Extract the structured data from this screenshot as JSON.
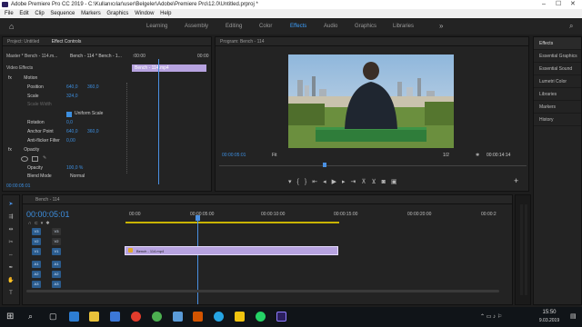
{
  "window": {
    "title": "Adobe Premiere Pro CC 2019 - C:\\Kullanıcılar\\user\\Belgeler\\Adobe\\Premiere Pro\\12.0\\Untitled.prproj *"
  },
  "menu": [
    "File",
    "Edit",
    "Clip",
    "Sequence",
    "Markers",
    "Graphics",
    "Window",
    "Help"
  ],
  "workspaces": [
    "Learning",
    "Assembly",
    "Editing",
    "Color",
    "Effects",
    "Audio",
    "Graphics",
    "Libraries"
  ],
  "active_workspace": "Effects",
  "effect_controls": {
    "tab_project": "Project: Untitled",
    "tab_effect": "Effect Controls",
    "master_label": "Master * Bench - 114.m...",
    "clip_label": "Bench - 114 * Bench - 1...",
    "time_start": ":00:00",
    "time_end": "00:00",
    "clip_bar_label": "Bench - 114.mp4",
    "video_effects": "Video Effects",
    "fx_motion": "Motion",
    "position_label": "Position",
    "position_x": "640,0",
    "position_y": "360,0",
    "scale_label": "Scale",
    "scale_value": "324,0",
    "scale_width_label": "Scale Width",
    "uniform_scale": "Uniform Scale",
    "rotation_label": "Rotation",
    "rotation_value": "0,0",
    "anchor_label": "Anchor Point",
    "anchor_x": "640,0",
    "anchor_y": "360,0",
    "antiflicker_label": "Anti-flicker Filter",
    "antiflicker_value": "0,00",
    "opacity_fx": "Opacity",
    "opacity_label": "Opacity",
    "opacity_value": "100,0 %",
    "blend_label": "Blend Mode",
    "blend_value": "Normal",
    "timecode": "00:00:05:01"
  },
  "program": {
    "title": "Program: Bench - 114",
    "timecode": "00:00:05:01",
    "fit": "Fit",
    "resolution": "1/2",
    "duration": "00:00:14:14"
  },
  "right_panel": {
    "title": "Effects",
    "items": [
      "Essential Graphics",
      "Essential Sound",
      "Lumetri Color",
      "Libraries",
      "Markers",
      "History"
    ]
  },
  "timeline": {
    "sequence_tab": "Bench - 114",
    "timecode": "00:00:05:01",
    "ruler": [
      "00:00",
      "00:00:05:00",
      "00:00:10:00",
      "00:00:15:00",
      "00:00:20:00",
      "00:00:2"
    ],
    "video_tracks": [
      "V3",
      "V2",
      "V1"
    ],
    "audio_tracks": [
      "A1",
      "A2",
      "A3"
    ],
    "clip_label": "Bench - 114.mp4"
  },
  "taskbar": {
    "time": "15:50",
    "date": "9.03.2019"
  },
  "colors": {
    "accent": "#3da1ff",
    "clip": "#b7a3e0",
    "track_blue": "#2b5c8e",
    "playhead": "#4a90e2"
  }
}
